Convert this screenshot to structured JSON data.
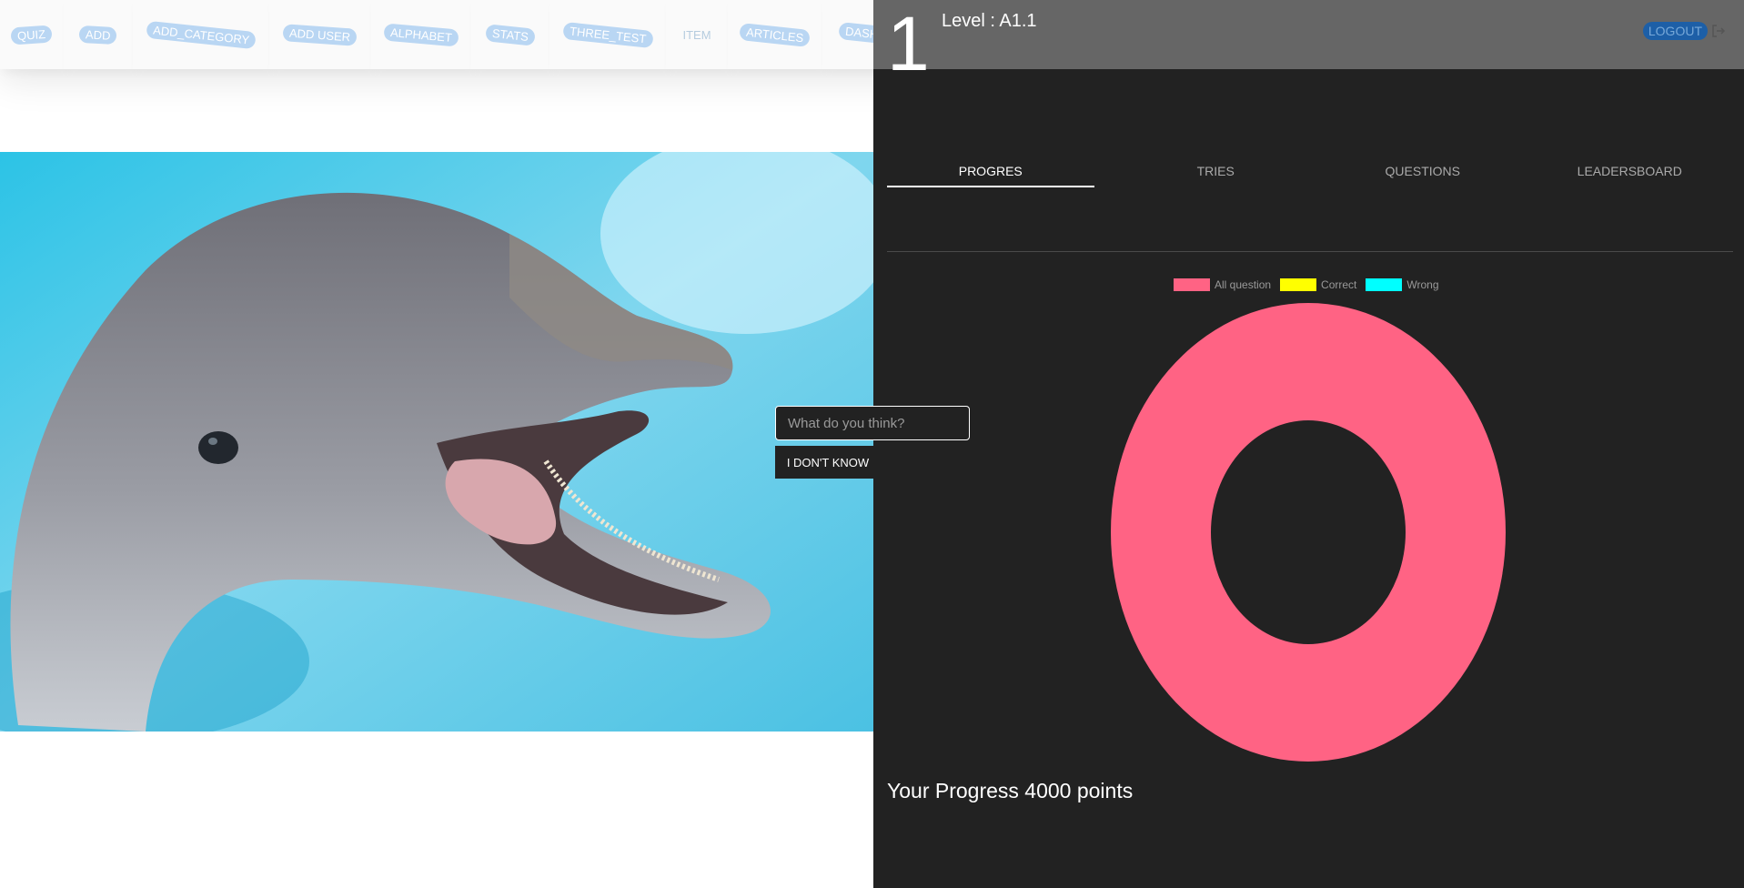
{
  "nav": {
    "items": [
      {
        "label": "QUIZ",
        "style": "pill"
      },
      {
        "label": "ADD",
        "style": "pill"
      },
      {
        "label": "ADD_CATEGORY",
        "style": "pill"
      },
      {
        "label": "ADD USER",
        "style": "pill"
      },
      {
        "label": "ALPHABET",
        "style": "pill"
      },
      {
        "label": "STATS",
        "style": "pill"
      },
      {
        "label": "THREE_TEST",
        "style": "pill"
      },
      {
        "label": "ITEM",
        "style": "plain"
      },
      {
        "label": "ARTICLES",
        "style": "pill"
      },
      {
        "label": "DASHBOARD",
        "style": "pill"
      }
    ]
  },
  "header": {
    "big_number": "1",
    "level_text": "Level : A1.1",
    "logout_label": "LOGOUT",
    "logout_icon": "logout-icon"
  },
  "tabs": [
    {
      "label": "PROGRES",
      "active": true
    },
    {
      "label": "TRIES",
      "active": false
    },
    {
      "label": "QUESTIONS",
      "active": false
    },
    {
      "label": "LEADERSBOARD",
      "active": false
    }
  ],
  "question": {
    "image": "dolphin-photo",
    "answer_placeholder": "What do you think?",
    "answer_value": "",
    "dont_know_label": "I DON'T KNOW"
  },
  "chart_data": {
    "type": "pie",
    "variant": "doughnut",
    "labels": [
      "All question",
      "Correct",
      "Wrong"
    ],
    "values": [
      1,
      0,
      0
    ],
    "colors": [
      "#ff6384",
      "#ffff00",
      "#00ffff"
    ],
    "legend_position": "top"
  },
  "progress_text": "Your Progress 4000 points",
  "colors": {
    "panel_bg": "#222222",
    "header_bg": "#666666",
    "nav_pill": "#b9d6f3",
    "logout_pill": "#1d5fa7"
  }
}
